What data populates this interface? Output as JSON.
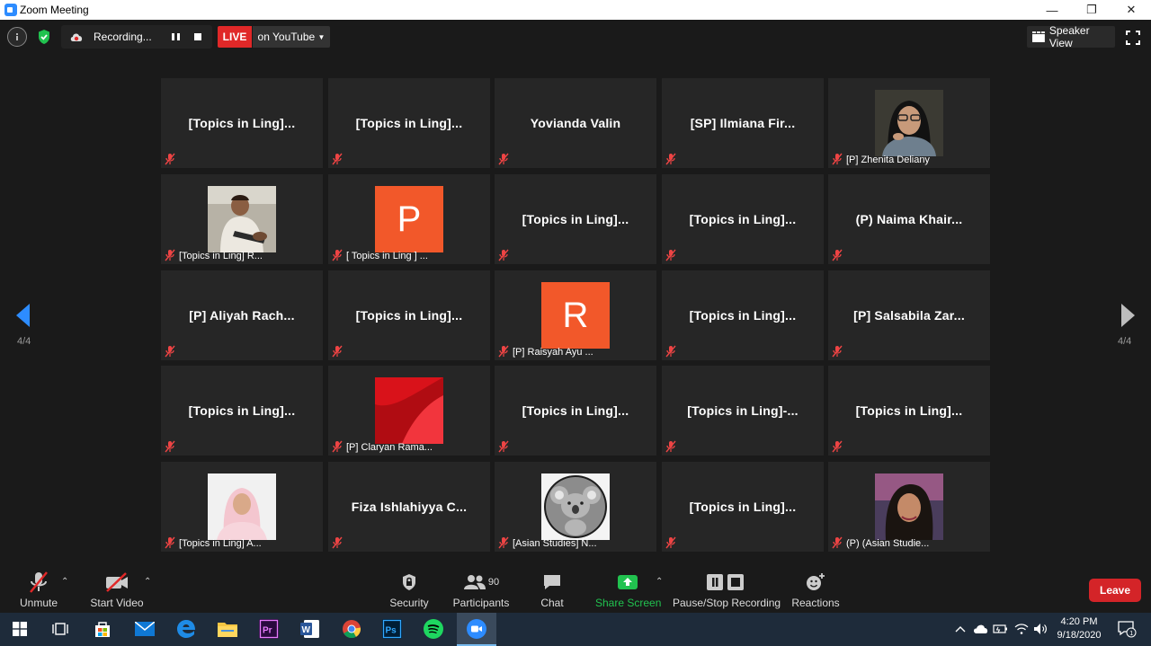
{
  "window": {
    "title": "Zoom Meeting"
  },
  "topbar": {
    "recording_label": "Recording...",
    "live_label": "LIVE",
    "stream_label": "on YouTube",
    "view_label": "Speaker View"
  },
  "gallery": {
    "page_left": "4/4",
    "page_right": "4/4",
    "tiles": [
      {
        "type": "name",
        "label": "[Topics in Ling]..."
      },
      {
        "type": "name",
        "label": "[Topics in Ling]..."
      },
      {
        "type": "name",
        "label": "Yovianda Valin"
      },
      {
        "type": "name",
        "label": "[SP] Ilmiana Fir..."
      },
      {
        "type": "photo",
        "caption": "[P] Zhenita Deliany",
        "photo": "woman-hijab-glasses"
      },
      {
        "type": "photo",
        "caption": "[Topics in Ling] R...",
        "photo": "child-photo"
      },
      {
        "type": "letter",
        "caption": "[ Topics in Ling ] ...",
        "letter": "P",
        "color": "#f2582a"
      },
      {
        "type": "name",
        "label": "[Topics in Ling]..."
      },
      {
        "type": "name",
        "label": "[Topics in Ling]..."
      },
      {
        "type": "name",
        "label": "(P) Naima Khair..."
      },
      {
        "type": "name",
        "label": "[P] Aliyah Rach..."
      },
      {
        "type": "name",
        "label": "[Topics in Ling]..."
      },
      {
        "type": "letter",
        "caption": "[P] Raisyah Ayu ...",
        "letter": "R",
        "color": "#f2582a"
      },
      {
        "type": "name",
        "label": "[Topics in Ling]..."
      },
      {
        "type": "name",
        "label": "[P] Salsabila Zar..."
      },
      {
        "type": "name",
        "label": "[Topics in Ling]..."
      },
      {
        "type": "abstract",
        "caption": "[P] Claryan Rama..."
      },
      {
        "type": "name",
        "label": "[Topics in Ling]..."
      },
      {
        "type": "name",
        "label": "[Topics in Ling]-..."
      },
      {
        "type": "name",
        "label": "[Topics in Ling]..."
      },
      {
        "type": "photo",
        "caption": "[Topics in Ling] A...",
        "photo": "woman-pink-hijab"
      },
      {
        "type": "name",
        "label": "Fiza Ishlahiyya C..."
      },
      {
        "type": "koala",
        "caption": "[Asian Studies] N..."
      },
      {
        "type": "name",
        "label": "[Topics in Ling]..."
      },
      {
        "type": "photo",
        "caption": "(P) (Asian Studie...",
        "photo": "woman-selfie"
      }
    ]
  },
  "toolbar": {
    "unmute": "Unmute",
    "start_video": "Start Video",
    "security": "Security",
    "participants": "Participants",
    "participants_count": "90",
    "chat": "Chat",
    "share_screen": "Share Screen",
    "recording": "Pause/Stop Recording",
    "reactions": "Reactions",
    "leave": "Leave"
  },
  "taskbar": {
    "time": "4:20 PM",
    "date": "9/18/2020",
    "notification_count": "1"
  },
  "colors": {
    "accent": "#2d8cff",
    "live": "#e02828",
    "leave": "#d42428",
    "share": "#21c24f"
  }
}
